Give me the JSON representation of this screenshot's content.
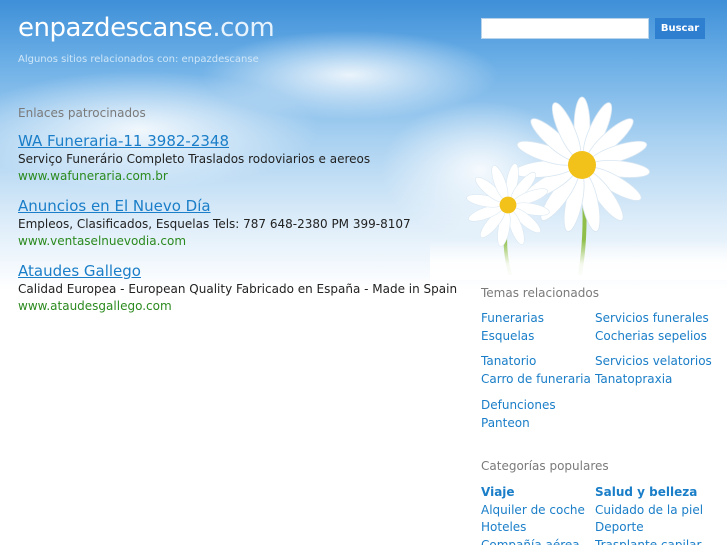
{
  "header": {
    "logo_name": "enpazdescanse",
    "logo_tld": ".com",
    "tagline": "Algunos sitios relacionados con: enpazdescanse"
  },
  "search": {
    "placeholder": "",
    "button_label": "Buscar"
  },
  "sponsored": {
    "heading": "Enlaces patrocinados",
    "ads": [
      {
        "title": "WA Funeraria-11 3982-2348",
        "description": "Serviço Funerário Completo Traslados rodoviarios e aereos",
        "url": "www.wafuneraria.com.br"
      },
      {
        "title": "Anuncios en El Nuevo Día",
        "description": "Empleos, Clasificados, Esquelas Tels: 787 648-2380 PM 399-8107",
        "url": "www.ventaselnuevodia.com"
      },
      {
        "title": "Ataudes Gallego",
        "description": "Calidad Europea - European Quality Fabricado en España - Made in Spain",
        "url": "www.ataudesgallego.com"
      }
    ]
  },
  "related": {
    "heading": "Temas relacionados",
    "groups": [
      [
        "Funerarias",
        "Servicios funerales",
        "Esquelas",
        "Cocherias sepelios"
      ],
      [
        "Tanatorio",
        "Servicios velatorios",
        "Carro de funeraria",
        "Tanatopraxia"
      ],
      [
        "Defunciones",
        "",
        "Panteon",
        ""
      ]
    ]
  },
  "popular": {
    "heading": "Categorías populares",
    "items": [
      "Viaje",
      "Salud y belleza",
      "Alquiler de coche",
      "Cuidado de la piel",
      "Hoteles",
      "Deporte",
      "Compañía aérea",
      "Trasplante capilar"
    ]
  }
}
